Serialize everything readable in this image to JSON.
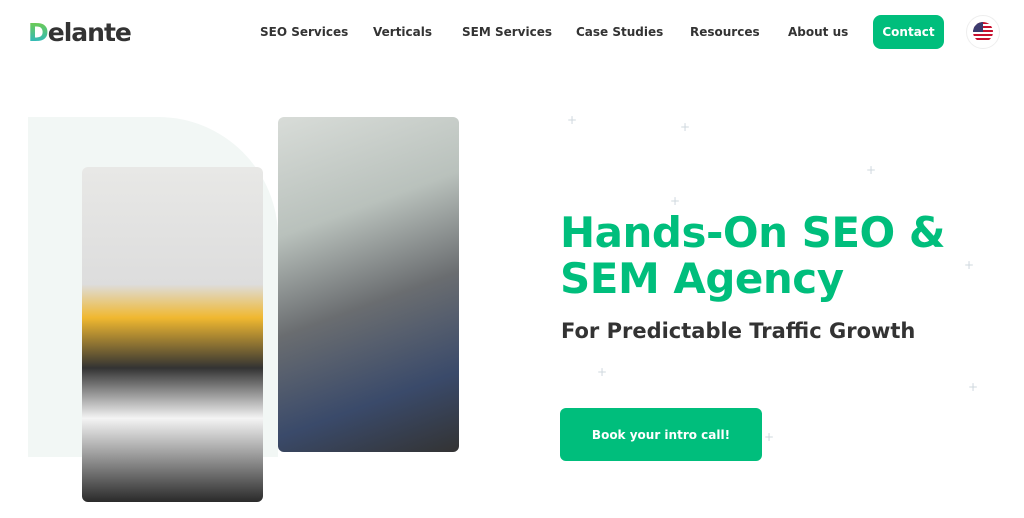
{
  "header": {
    "logo": "Delante",
    "logo_first": "D",
    "logo_rest": "elante",
    "nav": [
      "SEO Services",
      "Verticals",
      "SEM Services",
      "Case Studies",
      "Resources",
      "About us"
    ],
    "contact": "Contact",
    "language_icon": "us-flag-icon"
  },
  "hero": {
    "title": "Hands-On SEO & SEM Agency",
    "subtitle": "For Predictable Traffic Growth",
    "cta": "Book your intro call!"
  },
  "colors": {
    "accent": "#00be7c",
    "text": "#333333"
  }
}
